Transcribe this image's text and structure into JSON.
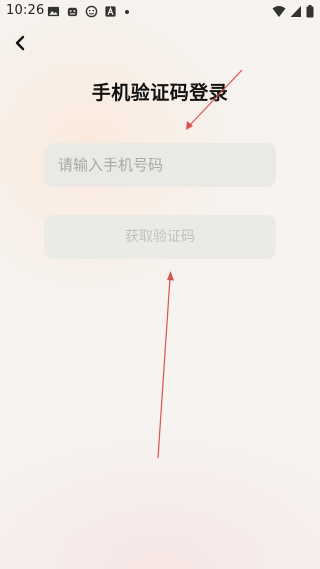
{
  "status_bar": {
    "time": "10:26"
  },
  "header": {
    "back_icon": "chevron-left-icon",
    "title": "手机验证码登录"
  },
  "form": {
    "phone_placeholder": "请输入手机号码",
    "phone_value": "",
    "code_button_label": "获取验证码"
  },
  "colors": {
    "annotation_arrow": "#d9534f",
    "input_bg": "#ebe9e6",
    "button_text_disabled": "#c2c1bf"
  }
}
